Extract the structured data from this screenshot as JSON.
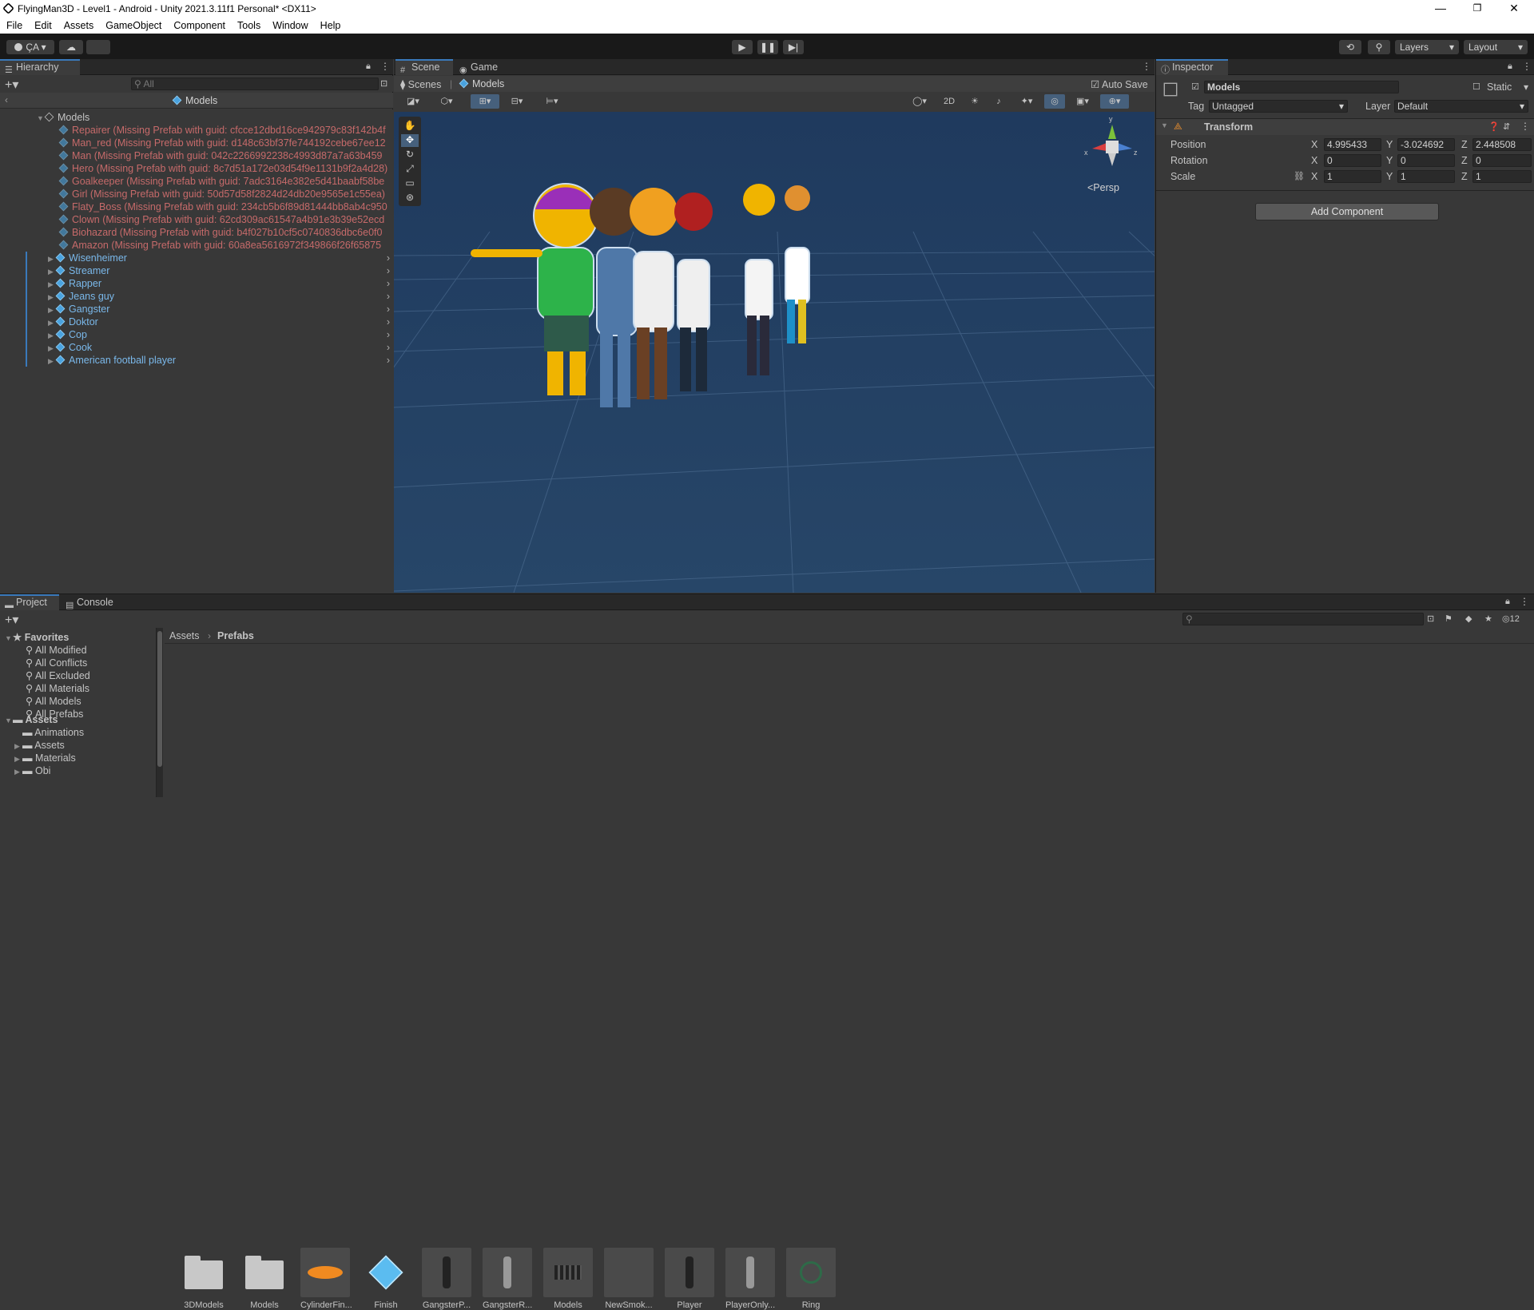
{
  "window": {
    "title": "FlyingMan3D - Level1 - Android - Unity 2021.3.11f1 Personal* <DX11>",
    "minimize": "—",
    "maximize": "❐",
    "close": "✕"
  },
  "menu": [
    "File",
    "Edit",
    "Assets",
    "GameObject",
    "Component",
    "Tools",
    "Window",
    "Help"
  ],
  "toolbar": {
    "account": "ÇA ▾",
    "layers": "Layers",
    "layout": "Layout"
  },
  "hierarchy": {
    "tab": "Hierarchy",
    "search_placeholder": "All",
    "breadcrumb": "Models",
    "root": "Models",
    "missing": [
      "Repairer (Missing Prefab with guid: cfcce12dbd16ce942979c83f142b4f",
      "Man_red (Missing Prefab with guid: d148c63bf37fe744192cebe67ee12",
      "Man (Missing Prefab with guid: 042c2266992238c4993d87a7a63b459",
      "Hero (Missing Prefab with guid: 8c7d51a172e03d54f9e1131b9f2a4d28)",
      "Goalkeeper (Missing Prefab with guid: 7adc3164e382e5d41baabf58be",
      "Girl (Missing Prefab with guid: 50d57d58f2824d24db20e9565e1c55ea)",
      "Flaty_Boss (Missing Prefab with guid: 234cb5b6f89d81444bb8ab4c950",
      "Clown (Missing Prefab with guid: 62cd309ac61547a4b91e3b39e52ecd",
      "Biohazard (Missing Prefab with guid: b4f027b10cf5c0740836dbc6e0f0",
      "Amazon (Missing Prefab with guid: 60a8ea5616972f349866f26f65875"
    ],
    "prefabs": [
      "Wisenheimer",
      "Streamer",
      "Rapper",
      "Jeans guy",
      "Gangster",
      "Doktor",
      "Cop",
      "Cook",
      "American football player"
    ]
  },
  "scene": {
    "tabs": [
      "Scene",
      "Game"
    ],
    "scenes_label": "Scenes",
    "models_label": "Models",
    "auto_save": "Auto Save",
    "mode_2d": "2D",
    "persp": "<Persp",
    "gizmo_x": "x",
    "gizmo_y": "y",
    "gizmo_z": "z"
  },
  "inspector": {
    "tab": "Inspector",
    "object_name": "Models",
    "static": "Static",
    "tag_label": "Tag",
    "tag_value": "Untagged",
    "layer_label": "Layer",
    "layer_value": "Default",
    "component": "Transform",
    "position_label": "Position",
    "rotation_label": "Rotation",
    "scale_label": "Scale",
    "position": {
      "x": "4.995433",
      "y": "-3.024692",
      "z": "2.448508"
    },
    "rotation": {
      "x": "0",
      "y": "0",
      "z": "0"
    },
    "scale": {
      "x": "1",
      "y": "1",
      "z": "1"
    },
    "add_component": "Add Component"
  },
  "project": {
    "tabs": [
      "Project",
      "Console"
    ],
    "hidden_count": "12",
    "breadcrumb_root": "Assets",
    "breadcrumb_current": "Prefabs",
    "favorites_label": "Favorites",
    "favorites": [
      "All Modified",
      "All Conflicts",
      "All Excluded",
      "All Materials",
      "All Models",
      "All Prefabs"
    ],
    "assets_label": "Assets",
    "assets_folders": [
      "Animations",
      "Assets",
      "Materials",
      "Obi"
    ],
    "items": [
      "3DModels",
      "Models",
      "CylinderFin...",
      "Finish",
      "GangsterP...",
      "GangsterR...",
      "Models",
      "NewSmok...",
      "Player",
      "PlayerOnly...",
      "Ring"
    ]
  }
}
